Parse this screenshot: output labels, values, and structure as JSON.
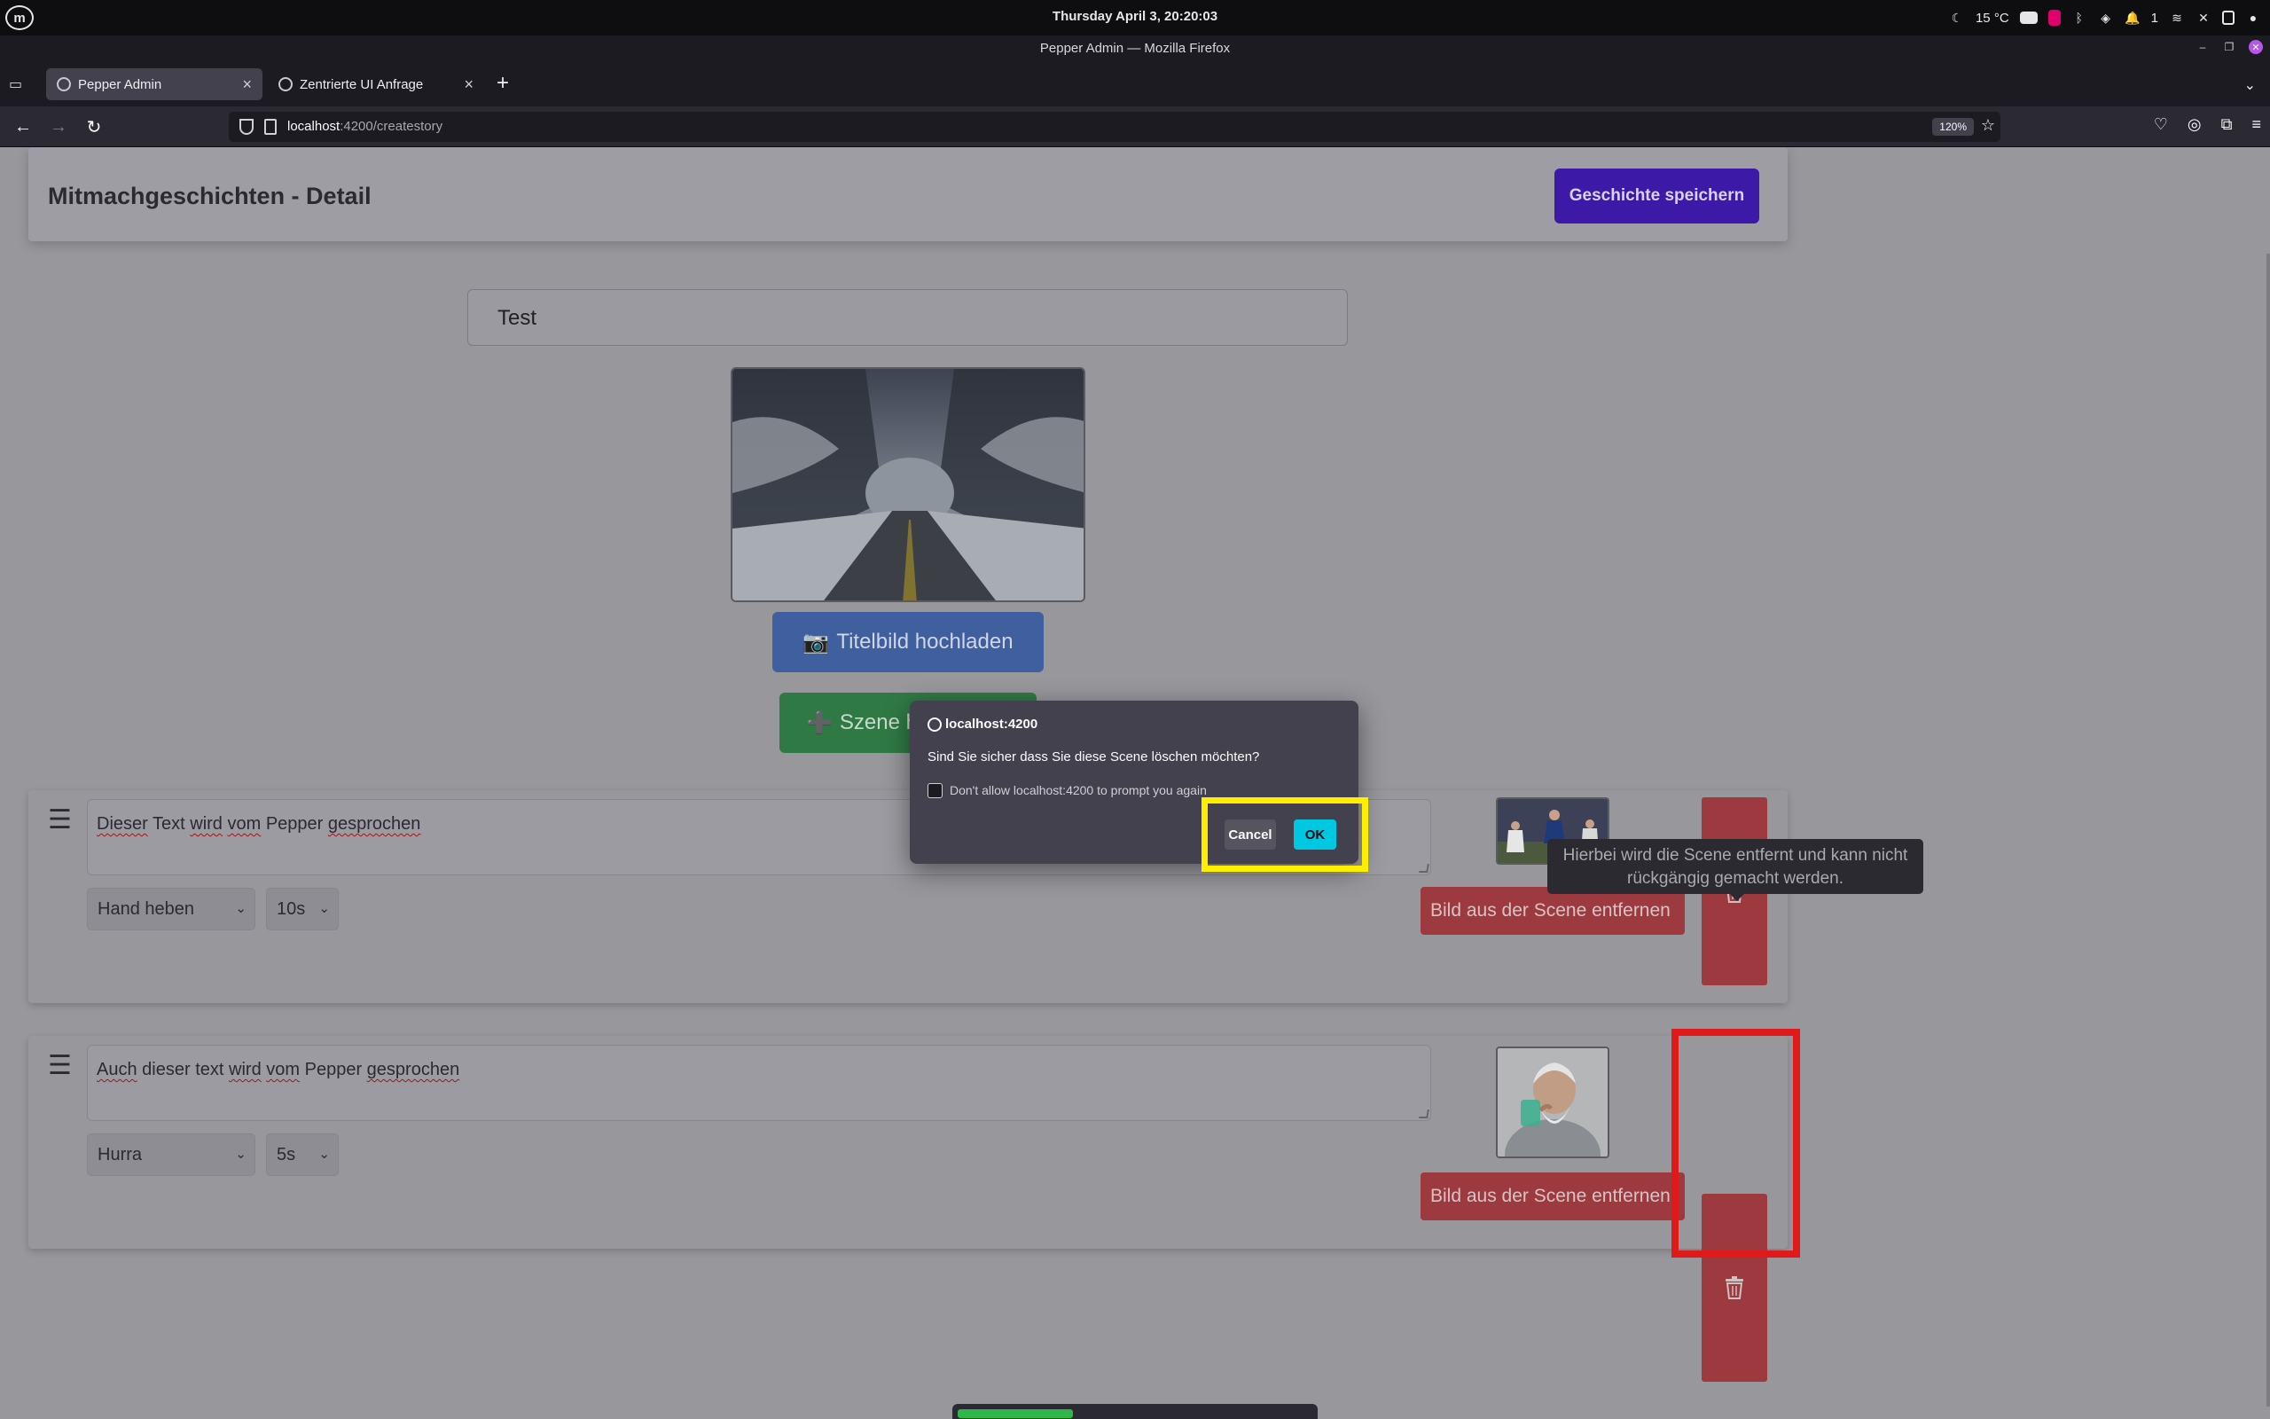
{
  "os": {
    "clock": "Thursday April 3, 20:20:03",
    "weather": "15 °C",
    "notification_count": "1"
  },
  "window": {
    "title": "Pepper Admin — Mozilla Firefox"
  },
  "tabs": [
    {
      "label": "Pepper Admin",
      "active": true
    },
    {
      "label": "Zentrierte UI Anfrage",
      "active": false
    }
  ],
  "url": {
    "host": "localhost",
    "path": ":4200/createstory",
    "zoom": "120%"
  },
  "page": {
    "title": "Mitmachgeschichten - Detail",
    "save_button": "Geschichte speichern",
    "story_title_value": "Test",
    "upload_cover_label": "Titelbild hochladen",
    "add_scene_label": "Szene h",
    "upload_icon": "📷",
    "add_icon": "➕"
  },
  "scenes": [
    {
      "text_words": [
        "Dieser",
        "Text",
        "wird",
        "vom",
        "Pepper",
        "gesprochen"
      ],
      "spell_flags": [
        true,
        false,
        true,
        true,
        false,
        true
      ],
      "action": "Hand heben",
      "duration": "10s",
      "remove_image_label": "Bild aus der Scene entfernen"
    },
    {
      "text_words": [
        "Auch",
        "dieser",
        "text",
        "wird",
        "vom",
        "Pepper",
        "gesprochen"
      ],
      "spell_flags": [
        true,
        false,
        false,
        true,
        true,
        false,
        true
      ],
      "action": "Hurra",
      "duration": "5s",
      "remove_image_label": "Bild aus der Scene entfernen"
    }
  ],
  "tooltip": {
    "line1": "Hierbei wird die Scene entfernt und kann nicht",
    "line2": "rückgängig gemacht werden."
  },
  "dialog": {
    "origin": "localhost:4200",
    "message": "Sind Sie sicher dass Sie diese Scene löschen möchten?",
    "checkbox_label": "Don't allow localhost:4200 to prompt you again",
    "checkbox_checked": false,
    "cancel": "Cancel",
    "ok": "OK"
  },
  "colors": {
    "highlight_red": "#e01a1a",
    "highlight_yellow": "#ffee00",
    "dialog_ok": "#00c8e0",
    "delete_red": "#9d3a3f",
    "save_purple": "#3c1aa7"
  }
}
